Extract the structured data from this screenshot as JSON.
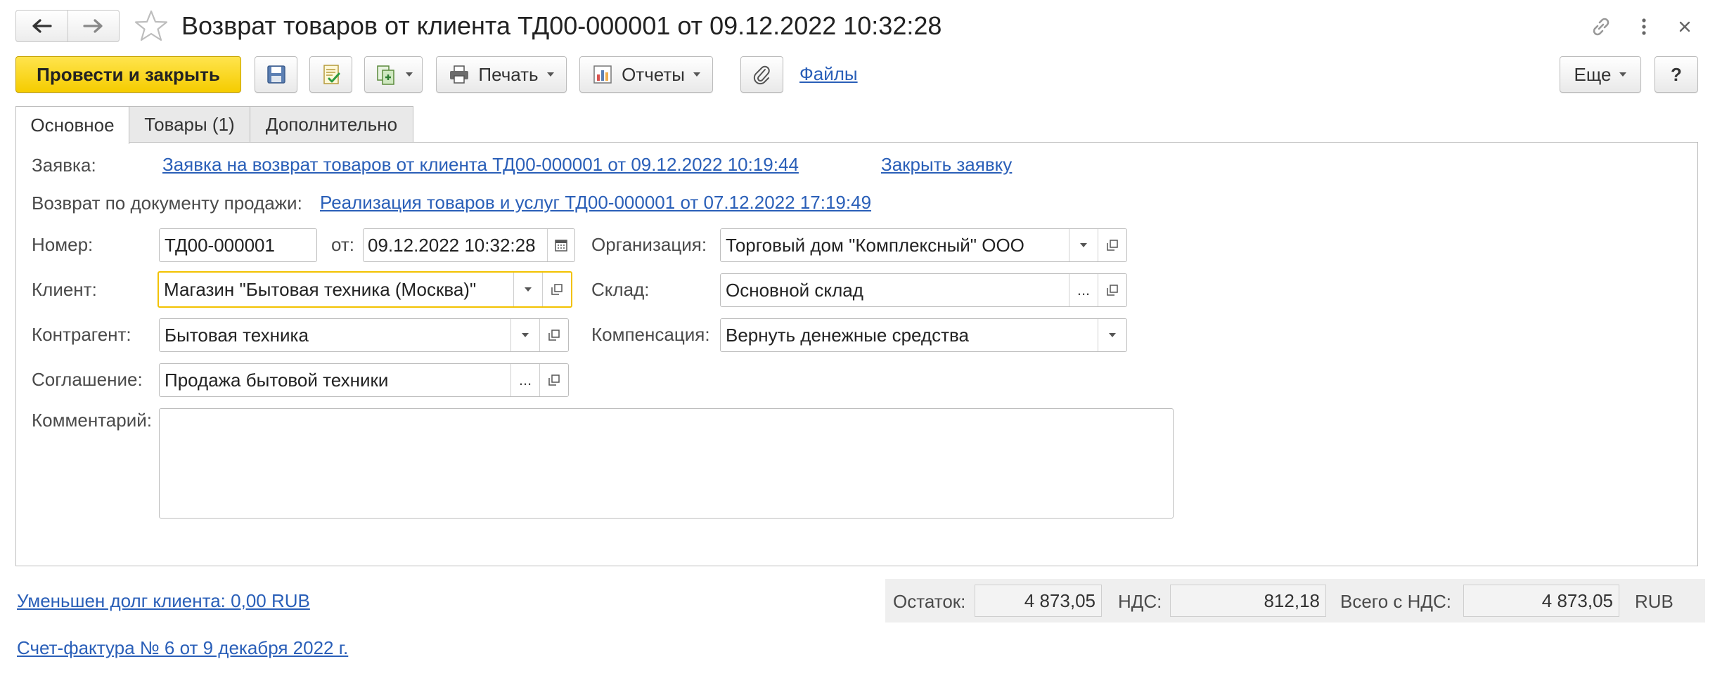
{
  "window": {
    "title": "Возврат товаров от клиента ТД00-000001 от 09.12.2022 10:32:28"
  },
  "toolbar": {
    "post_and_close": "Провести и закрыть",
    "print": "Печать",
    "reports": "Отчеты",
    "files": "Файлы",
    "more": "Еще",
    "help": "?"
  },
  "tabs": [
    {
      "label": "Основное"
    },
    {
      "label": "Товары (1)"
    },
    {
      "label": "Дополнительно"
    }
  ],
  "form": {
    "request_label": "Заявка:",
    "request_link": "Заявка на возврат товаров от клиента ТД00-000001 от 09.12.2022 10:19:44",
    "close_request": "Закрыть заявку",
    "sale_doc_label": "Возврат по документу продажи:",
    "sale_doc_link": "Реализация товаров и услуг ТД00-000001 от 07.12.2022 17:19:49",
    "number_label": "Номер:",
    "number_value": "ТД00-000001",
    "date_label": "от:",
    "date_value": "09.12.2022 10:32:28",
    "org_label": "Организация:",
    "org_value": "Торговый дом \"Комплексный\" ООО",
    "client_label": "Клиент:",
    "client_value": "Магазин \"Бытовая техника (Москва)\"",
    "warehouse_label": "Склад:",
    "warehouse_value": "Основной склад",
    "counterparty_label": "Контрагент:",
    "counterparty_value": "Бытовая техника",
    "compensation_label": "Компенсация:",
    "compensation_value": "Вернуть денежные средства",
    "agreement_label": "Соглашение:",
    "agreement_value": "Продажа бытовой техники",
    "comment_label": "Комментарий:",
    "comment_value": "",
    "ellipsis": "..."
  },
  "footer": {
    "debt_link": "Уменьшен долг клиента: 0,00 RUB",
    "invoice_link": "Счет-фактура № 6 от 9 декабря 2022 г.",
    "balance_label": "Остаток:",
    "balance_value": "4 873,05",
    "vat_label": "НДС:",
    "vat_value": "812,18",
    "total_label": "Всего с НДС:",
    "total_value": "4 873,05",
    "currency": "RUB"
  }
}
